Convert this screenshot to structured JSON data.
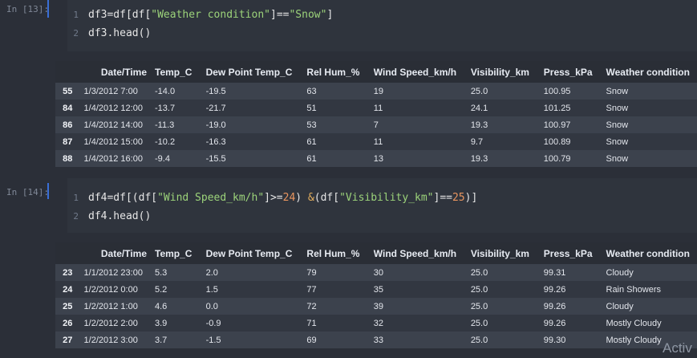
{
  "cells": [
    {
      "prompt": "In [13]:",
      "lines": [
        {
          "num": "1",
          "parts": [
            {
              "t": "df3=df[df[",
              "c": ""
            },
            {
              "t": "\"Weather condition\"",
              "c": "str"
            },
            {
              "t": "]==",
              "c": ""
            },
            {
              "t": "\"Snow\"",
              "c": "str"
            },
            {
              "t": "]",
              "c": ""
            }
          ]
        },
        {
          "num": "2",
          "parts": [
            {
              "t": "df3.head()",
              "c": ""
            }
          ]
        }
      ],
      "columns": [
        "",
        "Date/Time",
        "Temp_C",
        "Dew Point Temp_C",
        "Rel Hum_%",
        "Wind Speed_km/h",
        "Visibility_km",
        "Press_kPa",
        "Weather condition"
      ],
      "rows": [
        [
          "55",
          "1/3/2012 7:00",
          "-14.0",
          "-19.5",
          "63",
          "19",
          "25.0",
          "100.95",
          "Snow"
        ],
        [
          "84",
          "1/4/2012 12:00",
          "-13.7",
          "-21.7",
          "51",
          "11",
          "24.1",
          "101.25",
          "Snow"
        ],
        [
          "86",
          "1/4/2012 14:00",
          "-11.3",
          "-19.0",
          "53",
          "7",
          "19.3",
          "100.97",
          "Snow"
        ],
        [
          "87",
          "1/4/2012 15:00",
          "-10.2",
          "-16.3",
          "61",
          "11",
          "9.7",
          "100.89",
          "Snow"
        ],
        [
          "88",
          "1/4/2012 16:00",
          "-9.4",
          "-15.5",
          "61",
          "13",
          "19.3",
          "100.79",
          "Snow"
        ]
      ]
    },
    {
      "prompt": "In [14]:",
      "lines": [
        {
          "num": "1",
          "parts": [
            {
              "t": "df4=df[(df[",
              "c": ""
            },
            {
              "t": "\"Wind Speed_km/h\"",
              "c": "str"
            },
            {
              "t": "]>=",
              "c": ""
            },
            {
              "t": "24",
              "c": "num"
            },
            {
              "t": ") ",
              "c": ""
            },
            {
              "t": "&",
              "c": "op"
            },
            {
              "t": "(df[",
              "c": ""
            },
            {
              "t": "\"Visibility_km\"",
              "c": "str"
            },
            {
              "t": "]==",
              "c": ""
            },
            {
              "t": "25",
              "c": "num"
            },
            {
              "t": ")]",
              "c": ""
            }
          ]
        },
        {
          "num": "2",
          "parts": [
            {
              "t": "df4.head()",
              "c": ""
            }
          ]
        }
      ],
      "columns": [
        "",
        "Date/Time",
        "Temp_C",
        "Dew Point Temp_C",
        "Rel Hum_%",
        "Wind Speed_km/h",
        "Visibility_km",
        "Press_kPa",
        "Weather condition"
      ],
      "rows": [
        [
          "23",
          "1/1/2012 23:00",
          "5.3",
          "2.0",
          "79",
          "30",
          "25.0",
          "99.31",
          "Cloudy"
        ],
        [
          "24",
          "1/2/2012 0:00",
          "5.2",
          "1.5",
          "77",
          "35",
          "25.0",
          "99.26",
          "Rain Showers"
        ],
        [
          "25",
          "1/2/2012 1:00",
          "4.6",
          "0.0",
          "72",
          "39",
          "25.0",
          "99.26",
          "Cloudy"
        ],
        [
          "26",
          "1/2/2012 2:00",
          "3.9",
          "-0.9",
          "71",
          "32",
          "25.0",
          "99.26",
          "Mostly Cloudy"
        ],
        [
          "27",
          "1/2/2012 3:00",
          "3.7",
          "-1.5",
          "69",
          "33",
          "25.0",
          "99.30",
          "Mostly Cloudy"
        ]
      ]
    }
  ],
  "watermark": "Activ",
  "colors": {
    "background": "#2b2f38",
    "editor": "#2f343d",
    "string": "#9cd37a",
    "number": "#e9955f",
    "marker": "#3a6fd8"
  }
}
